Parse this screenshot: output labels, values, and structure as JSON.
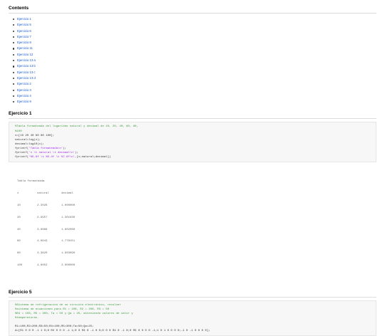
{
  "contents": {
    "heading": "Contents",
    "items": [
      "Ejercicio 1",
      "Ejercicio 5",
      "Ejercicio 6",
      "Ejercicio 7",
      "Ejercicio 8",
      "Ejercicio 11",
      "Ejercicio 12",
      "Ejercicio 13 a",
      "Ejercicio 13 b",
      "Ejercicio 13 c",
      "Ejercicio 13 d",
      "Ejercicio 2",
      "Ejercicio 3",
      "Ejercicio 4",
      "Ejercicio 9"
    ]
  },
  "sections": [
    {
      "title": "Ejercicio 1",
      "code": [
        "%Tabla formateada del logaritmo natural y decimal de 10, 20, 40, 60, 80,",
        "%100",
        "x=[10 20 40 60 80 100];",
        "natural=log(x);",
        "decimal=log10(x);",
        "fprintf('Tabla formateada\\n');",
        "fprintf('x \\t natural \\t decimal\\n');",
        "fprintf('%5.0f \\t %5.4f \\t %7.6f\\n',[x;natural;decimal])"
      ],
      "output_title": "Tabla formateada",
      "output_header": [
        "x",
        "natural",
        "decimal"
      ],
      "output_rows": [
        [
          "10",
          "2.3026",
          "1.000000"
        ],
        [
          "20",
          "2.9957",
          "1.301030"
        ],
        [
          "40",
          "3.6889",
          "1.602060"
        ],
        [
          "60",
          "4.0943",
          "1.778151"
        ],
        [
          "80",
          "4.3820",
          "1.903090"
        ],
        [
          "100",
          "4.6052",
          "2.000000"
        ]
      ]
    },
    {
      "title": "Ejercicio 5",
      "code": [
        "%Sistema de refrigeración de un circuito electrónico, resolver",
        "%sistema de ecuaciones para R1 = 100, R2 = 200, R3 = 50",
        "%R4 = 100, R5 = 300, Ta = 50 y Qa = 25, obteniendo valores de calor y",
        "%temperaturas.",
        "",
        "R1=100;R2=200;R3=50;R4=100;R5=300;Ta=50;Qa=25;",
        "A=[R1 0 0 0 -1 1 0;0 R2 0 0 0 -1 1;0 0 R3 0 -1 0 0;0 0 0 R4 0 -1 0;0 R5 0 0 0 0 -1;1 0 1 0 0 0 0;-1 0 -1 0 0 0 0];"
      ]
    }
  ]
}
